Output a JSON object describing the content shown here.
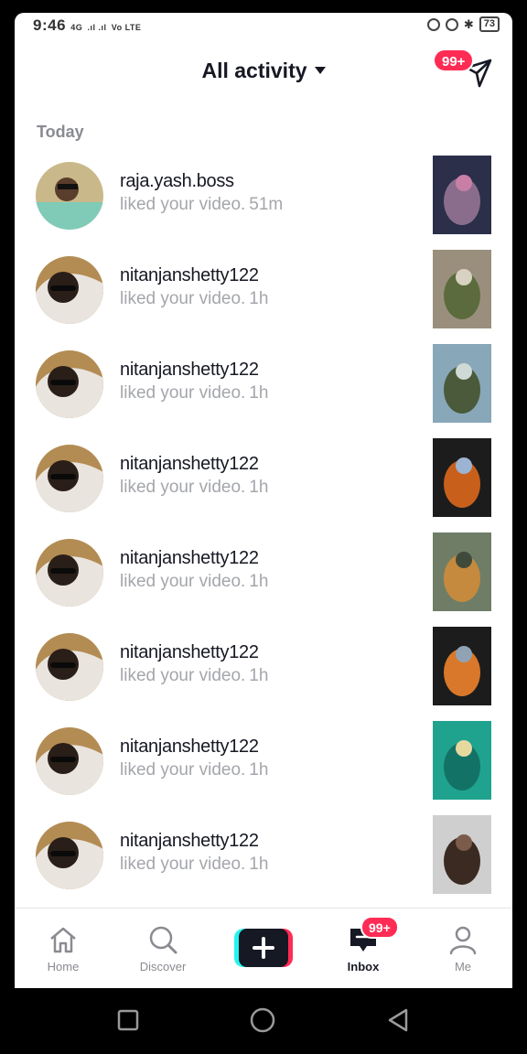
{
  "status_bar": {
    "time": "9:46",
    "network": "4G",
    "carrier": "Vo LTE",
    "battery": "73"
  },
  "header": {
    "title": "All activity",
    "send_badge": "99+"
  },
  "section": "Today",
  "notifications": [
    {
      "username": "raja.yash.boss",
      "action": "liked your video.",
      "time": "51m"
    },
    {
      "username": "nitanjanshetty122",
      "action": "liked your video.",
      "time": "1h"
    },
    {
      "username": "nitanjanshetty122",
      "action": "liked your video.",
      "time": "1h"
    },
    {
      "username": "nitanjanshetty122",
      "action": "liked your video.",
      "time": "1h"
    },
    {
      "username": "nitanjanshetty122",
      "action": "liked your video.",
      "time": "1h"
    },
    {
      "username": "nitanjanshetty122",
      "action": "liked your video.",
      "time": "1h"
    },
    {
      "username": "nitanjanshetty122",
      "action": "liked your video.",
      "time": "1h"
    },
    {
      "username": "nitanjanshetty122",
      "action": "liked your video.",
      "time": "1h"
    }
  ],
  "tabbar": {
    "home": "Home",
    "discover": "Discover",
    "inbox": "Inbox",
    "inbox_badge": "99+",
    "me": "Me"
  },
  "colors": {
    "accent": "#fe2c55",
    "cyan": "#25f4ee",
    "text_primary": "#161823",
    "text_secondary": "#a4a6ab"
  },
  "icons": [
    "home-icon",
    "search-icon",
    "plus-icon",
    "inbox-icon",
    "person-icon",
    "send-icon",
    "chevron-down-icon"
  ]
}
